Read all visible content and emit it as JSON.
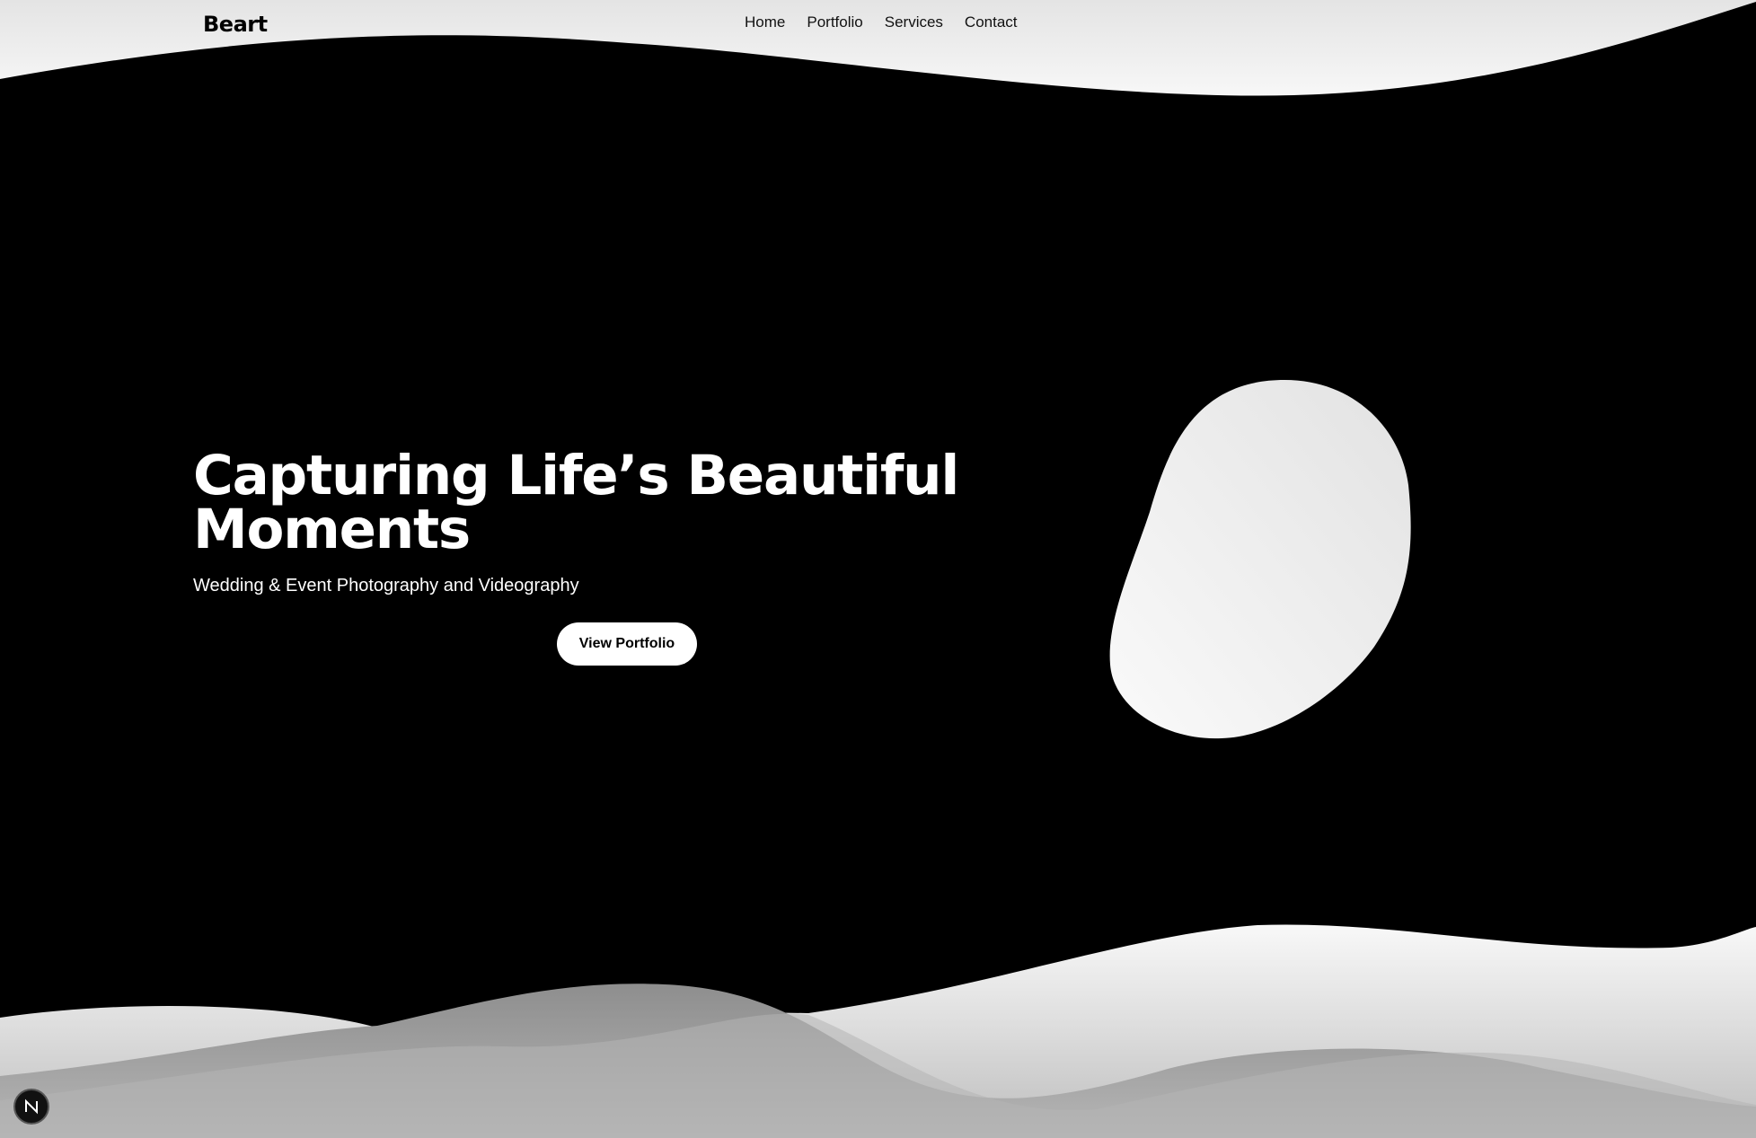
{
  "header": {
    "brand": "Beart",
    "nav": [
      {
        "label": "Home"
      },
      {
        "label": "Portfolio"
      },
      {
        "label": "Services"
      },
      {
        "label": "Contact"
      }
    ]
  },
  "hero": {
    "title_line1": "Capturing Life’s Beautiful",
    "title_line2": "Moments",
    "subtitle": "Wedding & Event Photography and Videography",
    "cta_label": "View Portfolio"
  },
  "badge": {
    "letter": "N",
    "icon": "n-logo-icon"
  },
  "colors": {
    "background": "#000000",
    "wave_light": "#f2f2f2",
    "wave_gray": "#9a9a9a",
    "blob": "#f0f0f0",
    "button_bg": "#ffffff"
  }
}
